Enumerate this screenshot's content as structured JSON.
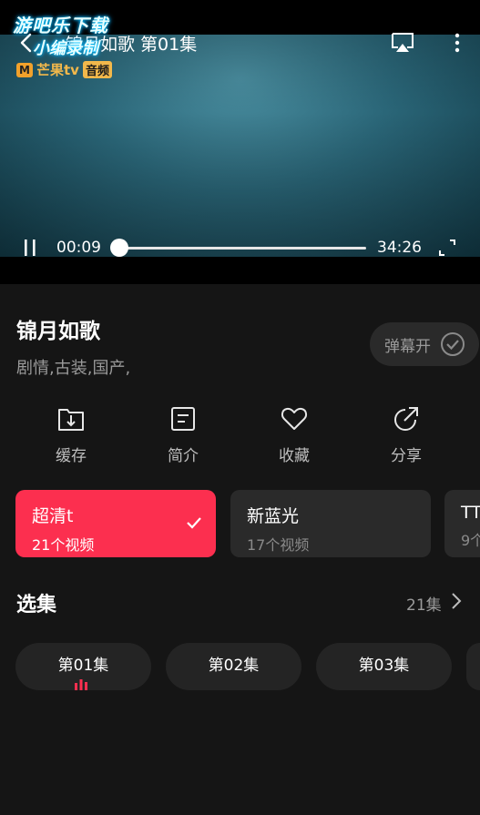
{
  "watermark": {
    "line1": "游吧乐下载",
    "line2": "小编录制"
  },
  "player": {
    "title": "锦月如歌 第01集",
    "brand_name": "芒果tv",
    "brand_tag": "音频",
    "current_time": "00:09",
    "total_time": "34:26",
    "progress": 0.004
  },
  "show": {
    "title": "锦月如歌",
    "tags": "剧情,古装,国产,",
    "danmaku_label": "弹幕开"
  },
  "actions": [
    {
      "label": "缓存",
      "icon": "download-icon"
    },
    {
      "label": "简介",
      "icon": "document-icon"
    },
    {
      "label": "收藏",
      "icon": "heart-icon"
    },
    {
      "label": "分享",
      "icon": "share-icon"
    }
  ],
  "qualities": [
    {
      "name": "超清t",
      "count": "21个视频",
      "selected": true
    },
    {
      "name": "新蓝光",
      "count": "17个视频",
      "selected": false
    },
    {
      "name": "TT",
      "count": "9个",
      "selected": false
    }
  ],
  "episodes": {
    "header": "选集",
    "total": "21集",
    "items": [
      {
        "label": "第01集",
        "playing": true
      },
      {
        "label": "第02集",
        "playing": false
      },
      {
        "label": "第03集",
        "playing": false
      }
    ]
  },
  "colors": {
    "accent": "#fc2f4f",
    "background": "#151515",
    "card": "#2a2a2a"
  }
}
